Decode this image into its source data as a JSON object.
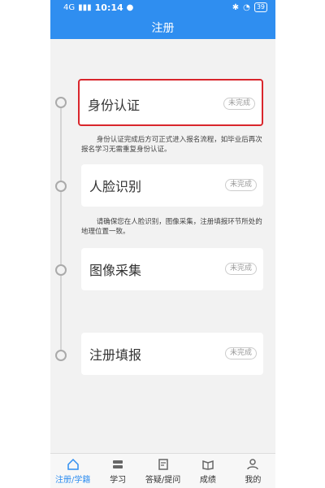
{
  "status_bar": {
    "network": "4G",
    "time": "10:14",
    "battery": "39"
  },
  "header": {
    "title": "注册"
  },
  "steps": [
    {
      "title": "身份认证",
      "status": "未完成"
    },
    {
      "title": "人脸识别",
      "status": "未完成"
    },
    {
      "title": "图像采集",
      "status": "未完成"
    },
    {
      "title": "注册填报",
      "status": "未完成"
    }
  ],
  "notes": {
    "identity": "身份认证完成后方可正式进入报名流程，如毕业后再次报名学习无需重复身份认证。",
    "face": "请确保您在人脸识别，图像采集，注册填报环节所处的地理位置一致。"
  },
  "nav": {
    "items": [
      {
        "label": "注册/学籍",
        "icon": "home-icon"
      },
      {
        "label": "学习",
        "icon": "study-icon"
      },
      {
        "label": "答疑/提问",
        "icon": "qa-icon"
      },
      {
        "label": "成绩",
        "icon": "grades-icon"
      },
      {
        "label": "我的",
        "icon": "profile-icon"
      }
    ]
  },
  "colors": {
    "brand": "#2f8ef0",
    "highlight": "#d9262c"
  }
}
